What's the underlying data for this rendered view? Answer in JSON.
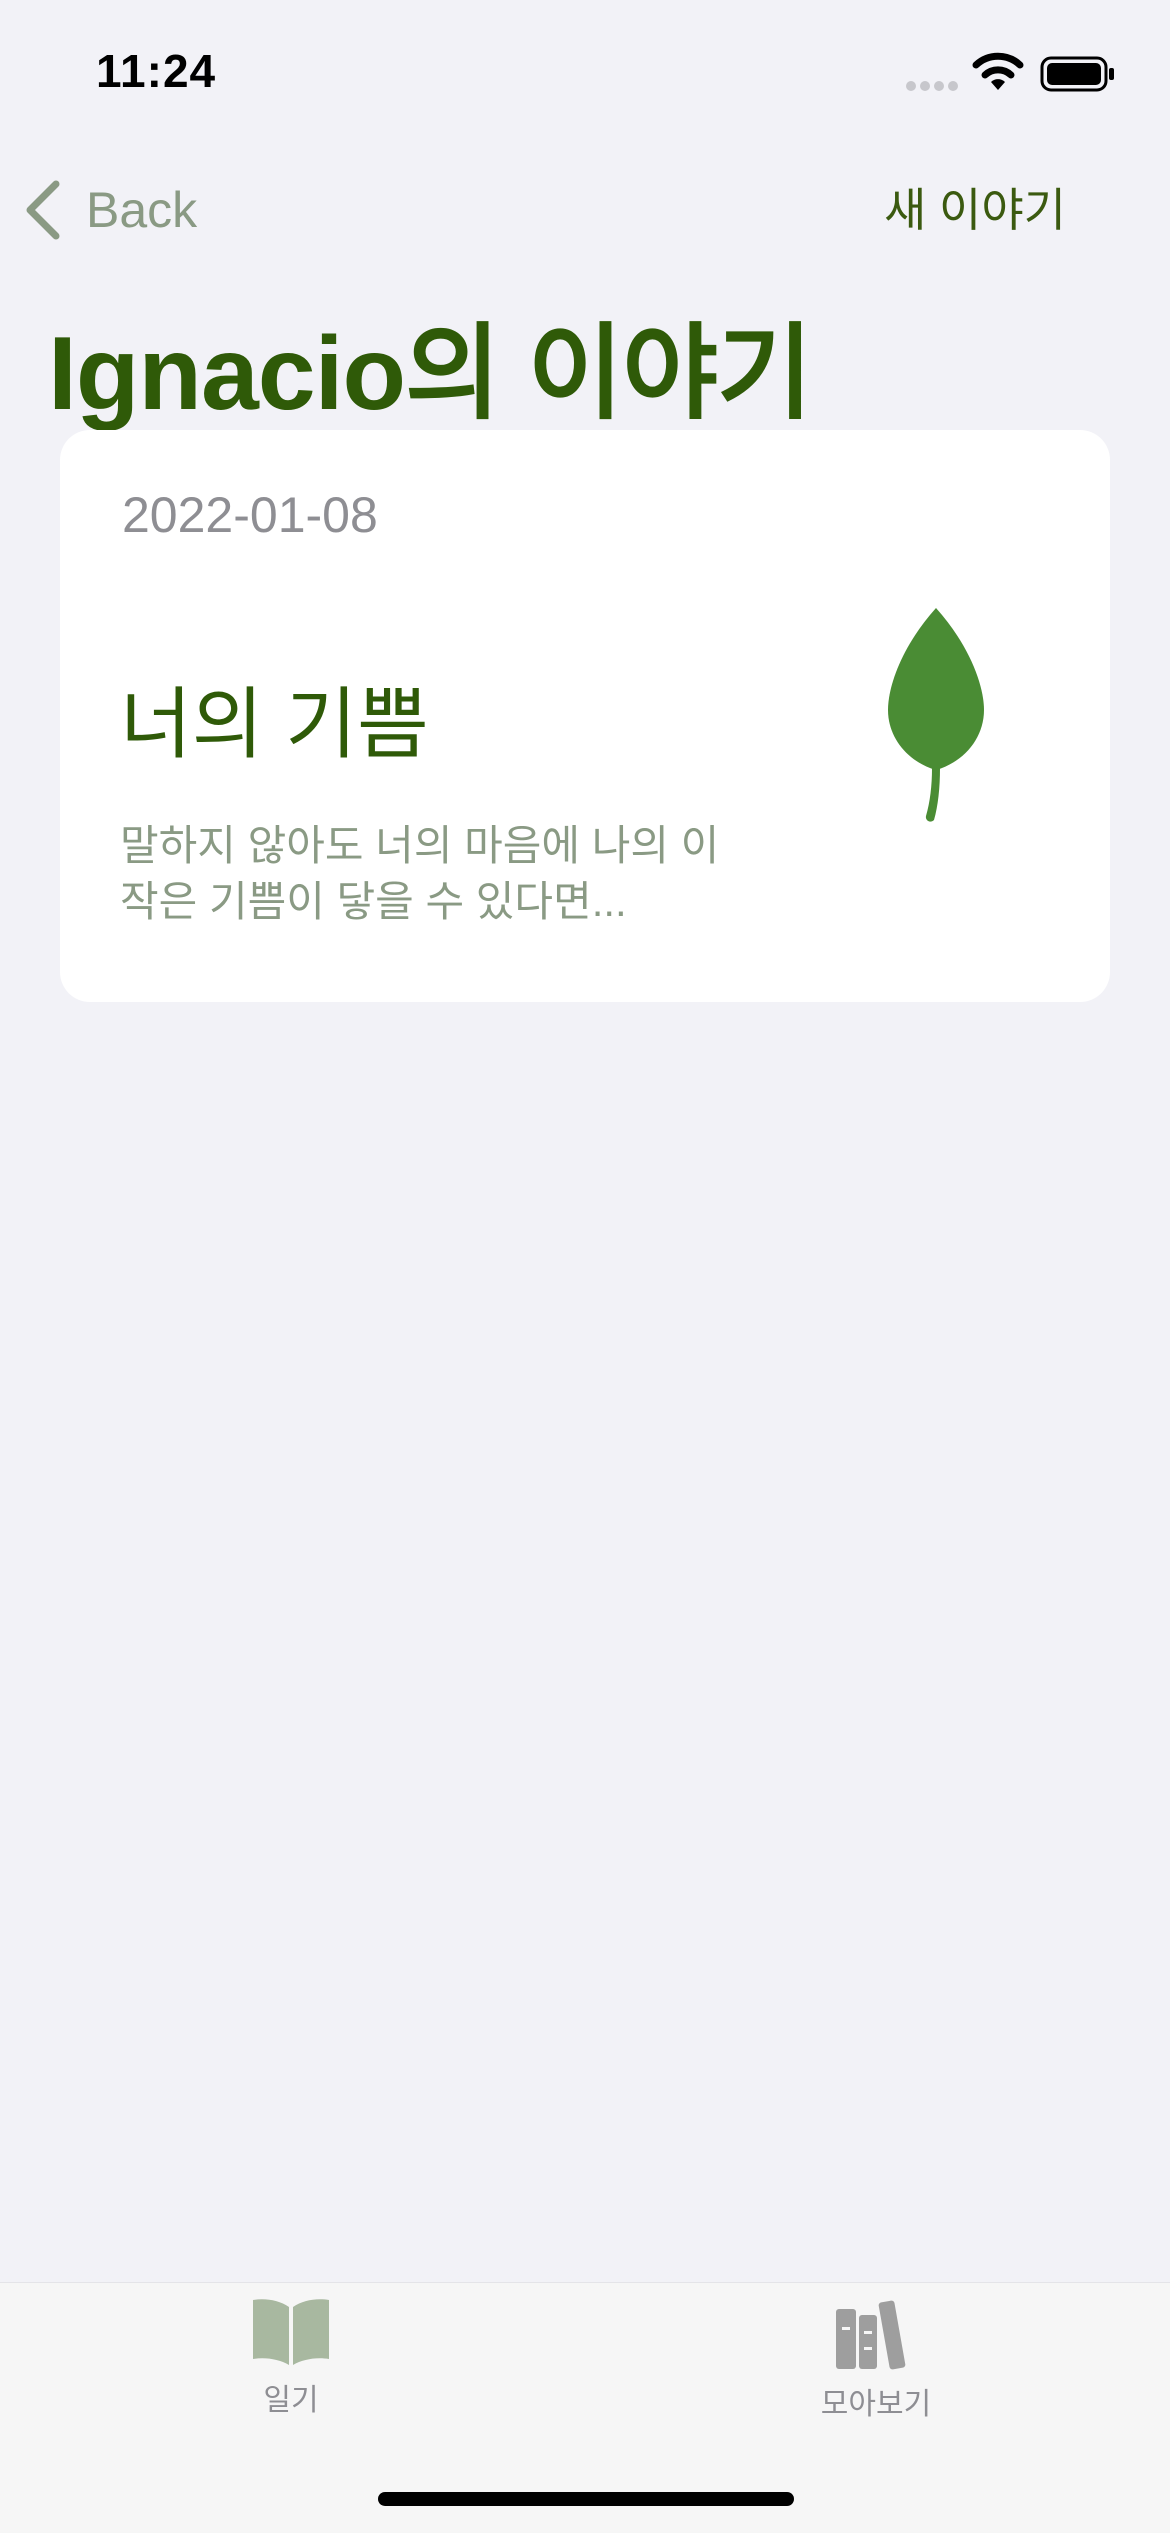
{
  "status_bar": {
    "time": "11:24"
  },
  "nav": {
    "back_label": "Back",
    "new_story_label": "새 이야기"
  },
  "page_title": "Ignacio의 이야기",
  "stories": [
    {
      "date": "2022-01-08",
      "title": "너의 기쁨",
      "excerpt": "말하지 않아도 너의 마음에 나의 이 작은 기쁨이 닿을 수 있다면...",
      "icon": "leaf-icon"
    }
  ],
  "tab_bar": {
    "tabs": [
      {
        "label": "일기",
        "icon": "open-book-icon"
      },
      {
        "label": "모아보기",
        "icon": "books-icon"
      }
    ]
  },
  "colors": {
    "accent_green": "#2f5a08",
    "leaf_green": "#4a8c34",
    "muted_green": "#8a9a84",
    "background": "#f2f2f7"
  }
}
